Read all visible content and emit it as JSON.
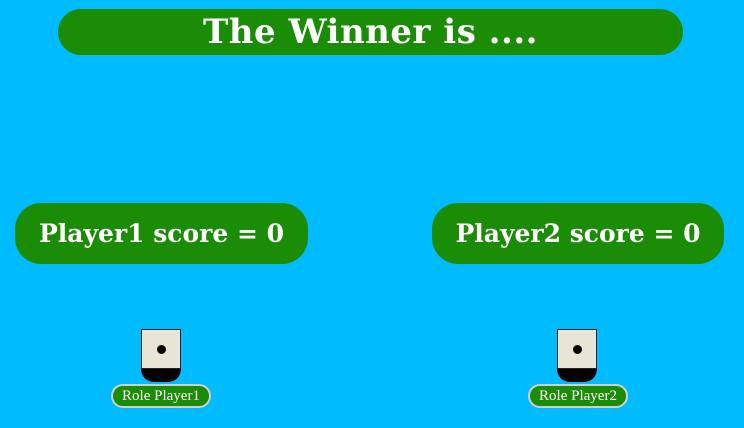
{
  "banner": {
    "text": "The Winner is ...."
  },
  "players": [
    {
      "score_text": "Player1 score = 0",
      "score": 0,
      "die_value": 1,
      "roll_button_label": "Role Player1"
    },
    {
      "score_text": "Player2 score = 0",
      "score": 0,
      "die_value": 1,
      "roll_button_label": "Role Player2"
    }
  ],
  "colors": {
    "background": "#00bbfe",
    "panel": "#1a8c05",
    "text": "#ffffff"
  }
}
